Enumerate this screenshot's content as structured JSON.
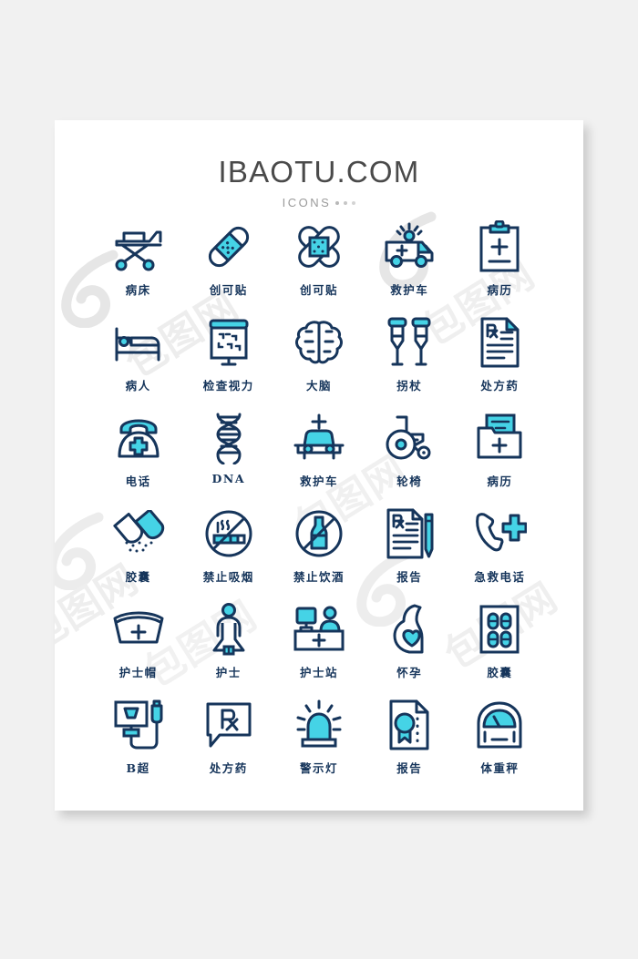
{
  "page": {
    "background_color": "#f1f1f1",
    "card_background": "#ffffff"
  },
  "header": {
    "title": "IBAOTU.COM",
    "subtitle": "ICONS",
    "dots": 3
  },
  "palette": {
    "stroke": "#16355b",
    "accent": "#45d3e6",
    "accent_light": "#6fe0ef",
    "title_color": "#4a4a4a",
    "subtitle_color": "#9a9a9a",
    "label_color": "#16355b",
    "watermark_color": "#e4e4e4"
  },
  "watermarks": [
    {
      "kind": "logo6",
      "label": "ibaotu-logo-watermark"
    },
    {
      "kind": "text",
      "label": "包图网"
    }
  ],
  "grid": {
    "columns": 5,
    "rows": 6,
    "icons": [
      {
        "icon": "hospital-bed-icon",
        "label": "病床"
      },
      {
        "icon": "bandage-icon",
        "label": "创可贴"
      },
      {
        "icon": "bandage-cross-icon",
        "label": "创可贴"
      },
      {
        "icon": "ambulance-van-icon",
        "label": "救护车"
      },
      {
        "icon": "clipboard-record-icon",
        "label": "病历"
      },
      {
        "icon": "patient-in-bed-icon",
        "label": "病人"
      },
      {
        "icon": "eye-chart-icon",
        "label": "检查视力"
      },
      {
        "icon": "brain-icon",
        "label": "大脑"
      },
      {
        "icon": "crutches-icon",
        "label": "拐杖"
      },
      {
        "icon": "prescription-page-icon",
        "label": "处方药"
      },
      {
        "icon": "telephone-icon",
        "label": "电话"
      },
      {
        "icon": "dna-icon",
        "label": "DNA"
      },
      {
        "icon": "ambulance-car-icon",
        "label": "救护车"
      },
      {
        "icon": "wheelchair-icon",
        "label": "轮椅"
      },
      {
        "icon": "folder-record-icon",
        "label": "病历"
      },
      {
        "icon": "capsule-icon",
        "label": "胶囊"
      },
      {
        "icon": "no-smoking-icon",
        "label": "禁止吸烟"
      },
      {
        "icon": "no-drinking-icon",
        "label": "禁止饮酒"
      },
      {
        "icon": "report-pen-icon",
        "label": "报告"
      },
      {
        "icon": "emergency-call-icon",
        "label": "急救电话"
      },
      {
        "icon": "nurse-cap-icon",
        "label": "护士帽"
      },
      {
        "icon": "nurse-icon",
        "label": "护士"
      },
      {
        "icon": "nurse-station-icon",
        "label": "护士站"
      },
      {
        "icon": "pregnancy-icon",
        "label": "怀孕"
      },
      {
        "icon": "pill-blister-icon",
        "label": "胶囊"
      },
      {
        "icon": "ultrasound-icon",
        "label": "B超"
      },
      {
        "icon": "prescription-bubble-icon",
        "label": "处方药"
      },
      {
        "icon": "warning-light-icon",
        "label": "警示灯"
      },
      {
        "icon": "certificate-report-icon",
        "label": "报告"
      },
      {
        "icon": "weight-scale-icon",
        "label": "体重秤"
      }
    ]
  }
}
